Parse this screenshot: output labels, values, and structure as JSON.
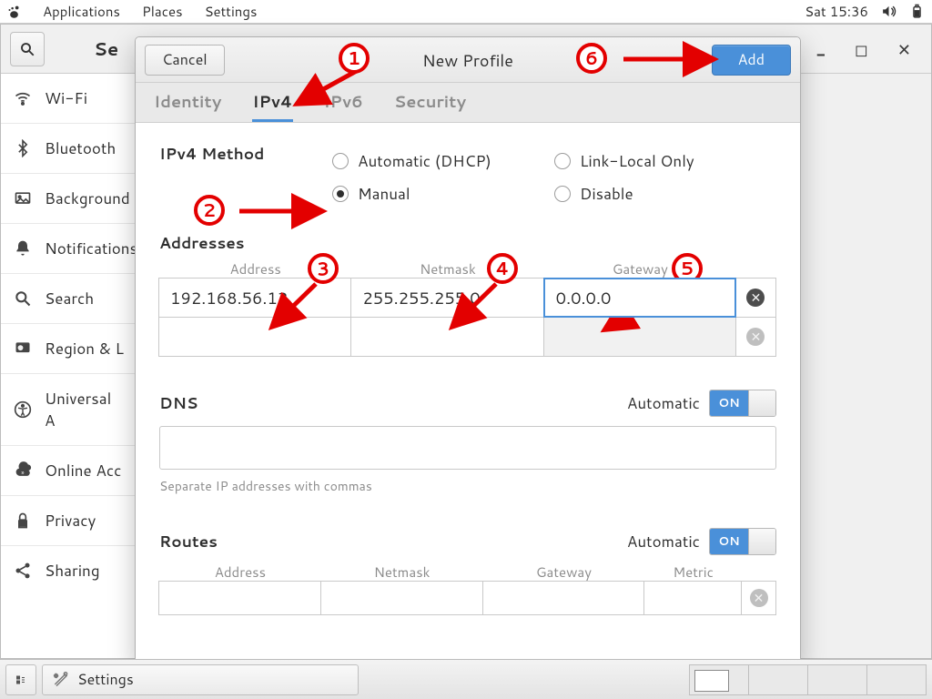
{
  "topbar": {
    "menus": [
      "Applications",
      "Places",
      "Settings"
    ],
    "clock": "Sat 15:36"
  },
  "settings": {
    "title": "Se",
    "sidebar": [
      {
        "icon": "wifi",
        "label": "Wi-Fi"
      },
      {
        "icon": "bluetooth",
        "label": "Bluetooth"
      },
      {
        "icon": "background",
        "label": "Background"
      },
      {
        "icon": "bell",
        "label": "Notifications"
      },
      {
        "icon": "search",
        "label": "Search"
      },
      {
        "icon": "region",
        "label": "Region & L"
      },
      {
        "icon": "universal",
        "label": "Universal A"
      },
      {
        "icon": "online",
        "label": "Online Acc"
      },
      {
        "icon": "privacy",
        "label": "Privacy"
      },
      {
        "icon": "sharing",
        "label": "Sharing"
      }
    ]
  },
  "dialog": {
    "cancel": "Cancel",
    "title": "New Profile",
    "add": "Add",
    "tabs": [
      "Identity",
      "IPv4",
      "IPv6",
      "Security"
    ],
    "active_tab": 1,
    "method_label": "IPv4 Method",
    "methods": {
      "auto": "Automatic (DHCP)",
      "linklocal": "Link-Local Only",
      "manual": "Manual",
      "disable": "Disable",
      "selected": "manual"
    },
    "addresses": {
      "title": "Addresses",
      "cols": [
        "Address",
        "Netmask",
        "Gateway"
      ],
      "rows": [
        {
          "address": "192.168.56.12",
          "netmask": "255.255.255.0",
          "gateway": "0.0.0.0",
          "focus": "gateway"
        },
        {
          "address": "",
          "netmask": "",
          "gateway": ""
        }
      ]
    },
    "dns": {
      "title": "DNS",
      "auto_label": "Automatic",
      "switch": "ON",
      "hint": "Separate IP addresses with commas"
    },
    "routes": {
      "title": "Routes",
      "auto_label": "Automatic",
      "switch": "ON",
      "cols": [
        "Address",
        "Netmask",
        "Gateway",
        "Metric"
      ]
    }
  },
  "taskbar": {
    "app": "Settings"
  },
  "annotations": [
    "1",
    "2",
    "3",
    "4",
    "5",
    "6"
  ]
}
